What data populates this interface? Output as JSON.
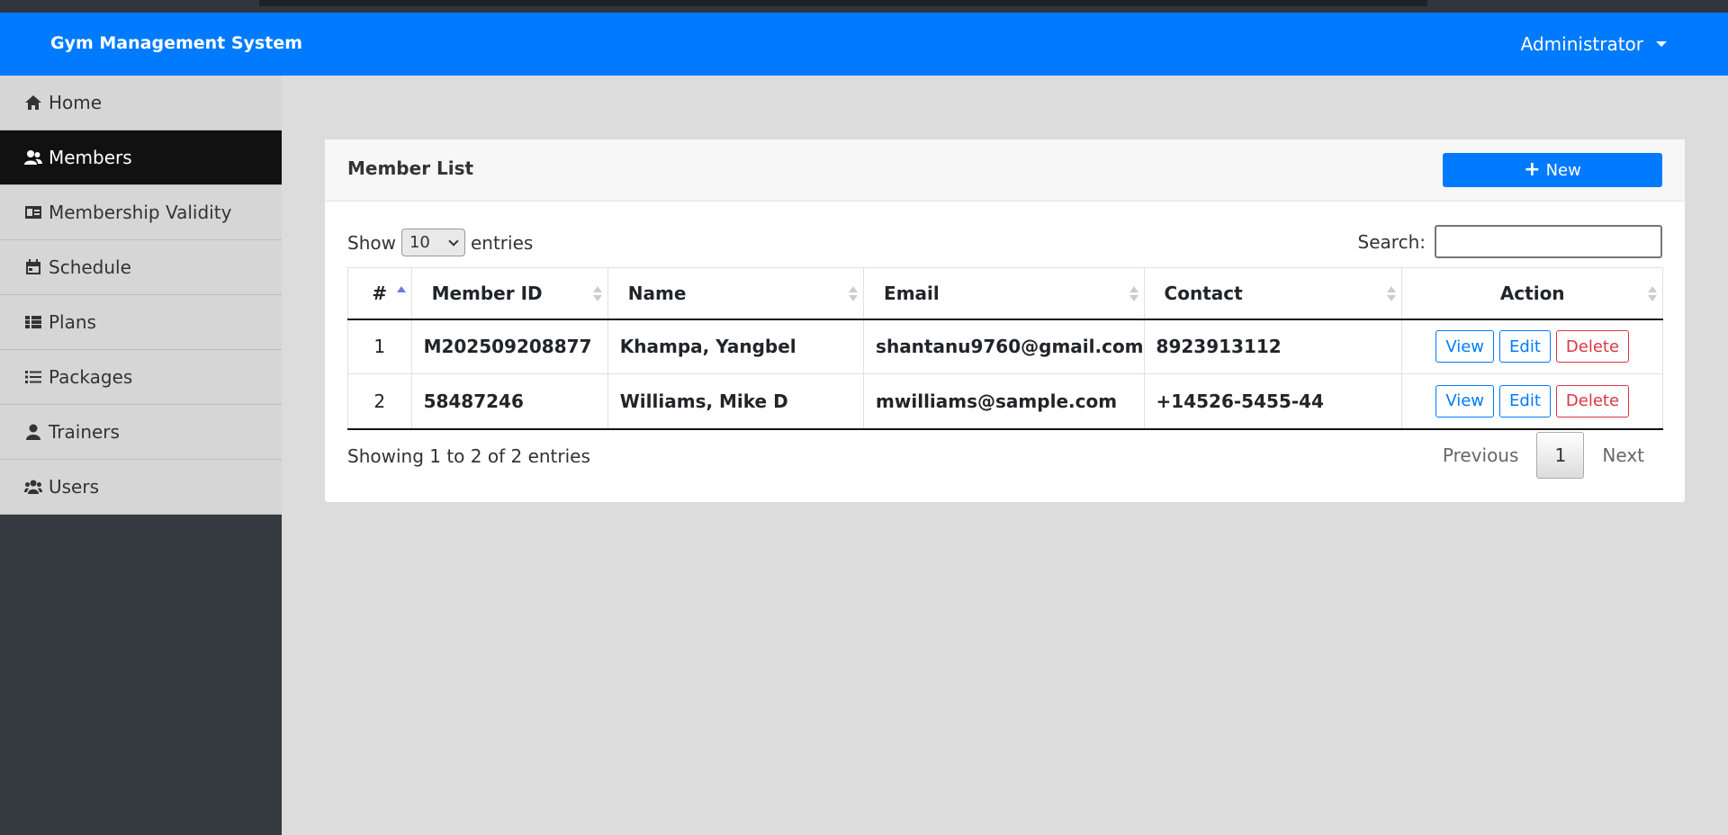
{
  "navbar": {
    "brand": "Gym Management System",
    "user": "Administrator"
  },
  "sidebar": {
    "items": [
      {
        "label": "Home",
        "icon": "home-icon"
      },
      {
        "label": "Members",
        "icon": "users-icon",
        "active": true
      },
      {
        "label": "Membership Validity",
        "icon": "id-card-icon"
      },
      {
        "label": "Schedule",
        "icon": "calendar-icon"
      },
      {
        "label": "Plans",
        "icon": "table-list-icon"
      },
      {
        "label": "Packages",
        "icon": "list-icon"
      },
      {
        "label": "Trainers",
        "icon": "user-icon"
      },
      {
        "label": "Users",
        "icon": "user-group-icon"
      }
    ]
  },
  "card": {
    "title": "Member List",
    "new_label": "New"
  },
  "controls": {
    "show_label": "Show",
    "length_value": "10",
    "entries_label": "entries",
    "search_label": "Search:",
    "search_value": ""
  },
  "table": {
    "headers": [
      "#",
      "Member ID",
      "Name",
      "Email",
      "Contact",
      "Action"
    ],
    "rows": [
      {
        "num": "1",
        "member_id": "M202509208877",
        "name": "Khampa, Yangbel",
        "email": "shantanu9760@gmail.com",
        "contact": "8923913112"
      },
      {
        "num": "2",
        "member_id": "58487246",
        "name": "Williams, Mike D",
        "email": "mwilliams@sample.com",
        "contact": "+14526-5455-44"
      }
    ],
    "actions": {
      "view": "View",
      "edit": "Edit",
      "delete": "Delete"
    }
  },
  "footer": {
    "info": "Showing 1 to 2 of 2 entries",
    "previous": "Previous",
    "current_page": "1",
    "next": "Next"
  },
  "colors": {
    "primary": "#007bff",
    "danger": "#dc3545",
    "sidebar_active": "#111111"
  }
}
